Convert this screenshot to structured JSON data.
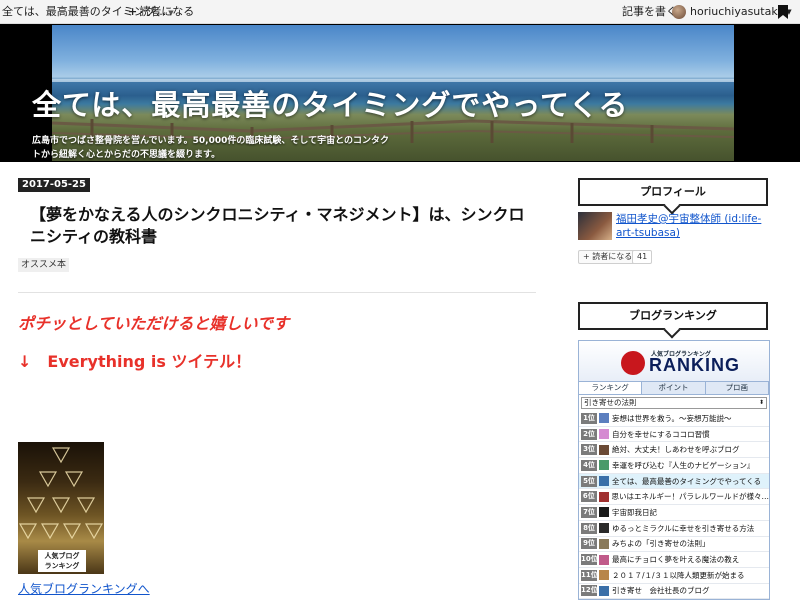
{
  "topbar": {
    "blog_title": "全ては、最高最善のタイミング...",
    "subscribe_label": "読者になる",
    "write_label": "記事を書く",
    "username": "horiuchiyasutaka"
  },
  "header": {
    "title": "全ては、最高最善のタイミングでやってくる",
    "description": "広島市でつばさ整骨院を営んでいます。50,000件の臨床試験、そして宇宙とのコンタクトから紐解く心とからだの不思議を綴ります。"
  },
  "entry": {
    "date": "2017-05-25",
    "title": "【夢をかなえる人のシンクロニシティ・マネジメント】は、シンクロニシティの教科書",
    "category": "オススメ本",
    "red_line_1": "ポチッとしていただけると嬉しいです",
    "arrow": "↓",
    "red_line_2": "Everything is ツイテル！",
    "banner_badge": "人気ブログ\nランキング",
    "ranking_link": "人気ブログランキングへ"
  },
  "sidebar": {
    "profile_heading": "プロフィール",
    "profile_name": "福田孝史@宇宙整体師 (id:life-art-tsubasa)",
    "reader_button": "+ 読者になる",
    "reader_count": "41",
    "ranking_heading": "ブログランキング",
    "ranking": {
      "logo_small": "人気ブログランキング",
      "logo_big": "RANKING",
      "tabs": [
        "ランキング",
        "ポイント",
        "プロ画"
      ],
      "select_value": "引き寄せの法則",
      "rows": [
        {
          "rank": "1位",
          "title": "妄想は世界を救う。～妄想万能説～",
          "color": "#5c7fbf"
        },
        {
          "rank": "2位",
          "title": "自分を幸せにするココロ習慣",
          "color": "#d58bd1"
        },
        {
          "rank": "3位",
          "title": "絶対、大丈夫！しあわせを呼ぶブログ",
          "color": "#6b4a36"
        },
        {
          "rank": "4位",
          "title": "幸運を呼び込む『人生のナビゲーション』",
          "color": "#4a9a6a"
        },
        {
          "rank": "5位",
          "title": "全ては、最高最善のタイミングでやってくる",
          "color": "#3a6fa8"
        },
        {
          "rank": "6位",
          "title": "思いはエネルギー！パラレルワールドが様々…",
          "color": "#a03030"
        },
        {
          "rank": "7位",
          "title": "宇宙即我日記",
          "color": "#1a1a1a"
        },
        {
          "rank": "8位",
          "title": "ゆるっとミラクルに幸せを引き寄せる方法",
          "color": "#2a2a2a"
        },
        {
          "rank": "9位",
          "title": "みちよの「引き寄せの法則」",
          "color": "#8a7a5a"
        },
        {
          "rank": "10位",
          "title": "最高にチョロく夢を叶える魔法の教え",
          "color": "#c05a8a"
        },
        {
          "rank": "11位",
          "title": "２０１７/１/３１以降人類更新が始まる",
          "color": "#b8864a"
        },
        {
          "rank": "12位",
          "title": "引き寄せ　会社社長のブログ",
          "color": "#3a6fa8"
        }
      ],
      "highlight_index": 4
    }
  }
}
